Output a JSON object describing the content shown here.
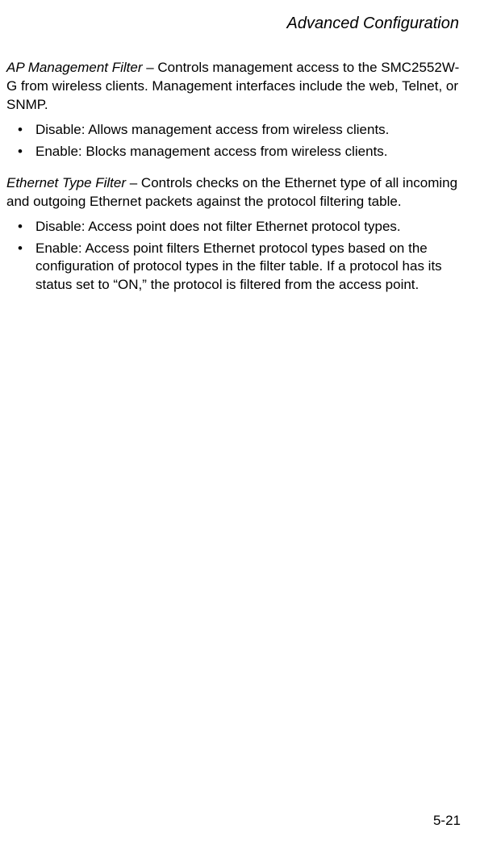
{
  "header": {
    "title": "Advanced Configuration"
  },
  "sections": [
    {
      "term": "AP Management Filter",
      "desc": " – Controls management access to the SMC2552W-G from wireless clients. Management interfaces include the web, Telnet, or SNMP.",
      "bullets": [
        "Disable: Allows management access from wireless clients.",
        "Enable: Blocks management access from wireless clients."
      ]
    },
    {
      "term": "Ethernet Type Filter",
      "desc": " – Controls checks on the Ethernet type of all incoming and outgoing Ethernet packets against the protocol filtering table.",
      "bullets": [
        "Disable: Access point does not filter Ethernet protocol types.",
        "Enable: Access point filters Ethernet protocol types based on the configuration of protocol types in the filter table. If a protocol has its status set to “ON,” the protocol is filtered from the access point."
      ]
    }
  ],
  "footer": {
    "page": "5-21"
  }
}
